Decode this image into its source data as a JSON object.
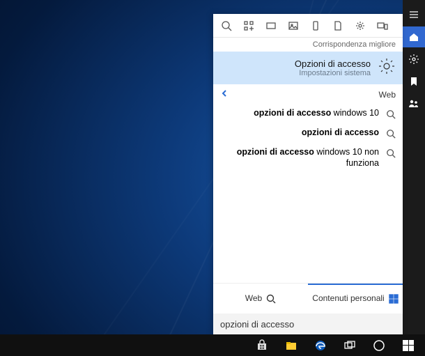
{
  "section_best": "Corrispondenza migliore",
  "best": {
    "title": "Opzioni di accesso",
    "subtitle": "Impostazioni sistema"
  },
  "web_label": "Web",
  "suggestions": [
    {
      "prefix": "opzioni di accesso",
      "suffix": " windows 10"
    },
    {
      "prefix": "opzioni di accesso",
      "suffix": ""
    },
    {
      "prefix": "opzioni di accesso",
      "suffix": " windows 10 non funziona"
    }
  ],
  "tabs": {
    "personal": "Contenuti personali",
    "web": "Web"
  },
  "search_value": "opzioni di accesso"
}
